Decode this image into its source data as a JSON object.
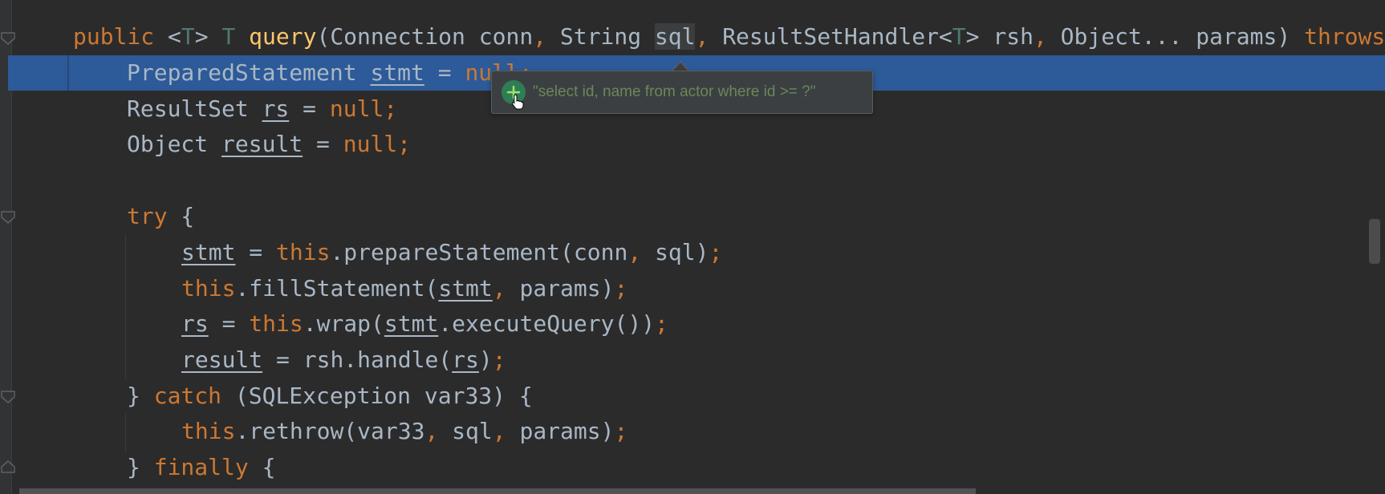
{
  "editor": {
    "selected_identifier": "sql"
  },
  "code": {
    "line1": {
      "kw_public": "public",
      "lt": " <",
      "t1": "T",
      "gt": "> ",
      "t2": "T",
      "sp": " ",
      "fn_query": "query",
      "args1": "(Connection conn",
      "c1": ",",
      "args2": " String ",
      "sql": "sql",
      "c2": ",",
      "args3": " ResultSetHandler<",
      "t3": "T",
      "args4": "> rsh",
      "c3": ",",
      "args5": " Object... params) ",
      "kw_throws": "throws"
    },
    "line2": {
      "type": "PreparedStatement ",
      "var": "stmt",
      "eq": " = ",
      "nul": "null;"
    },
    "line3": {
      "type": "ResultSet ",
      "var": "rs",
      "eq": " = ",
      "nul": "null;"
    },
    "line4": {
      "type": "Object ",
      "var": "result",
      "eq": " = ",
      "nul": "null;"
    },
    "line5": {
      "kw": "try",
      "rest": " {"
    },
    "line6": {
      "var": "stmt",
      "eq": " = ",
      "kw": "this",
      "call": ".prepareStatement(conn",
      "comma": ",",
      "rest": " sql)",
      "semi": ";"
    },
    "line7": {
      "kw": "this",
      "call": ".fillStatement(",
      "var": "stmt",
      "comma": ",",
      "rest": " params)",
      "semi": ";"
    },
    "line8": {
      "var": "rs",
      "eq": " = ",
      "kw": "this",
      "call": ".wrap(",
      "var2": "stmt",
      "rest": ".executeQuery())",
      "semi": ";"
    },
    "line9": {
      "var": "result",
      "call": " = rsh.handle(",
      "var2": "rs",
      "rest": ")",
      "semi": ";"
    },
    "line10": {
      "brace": "} ",
      "kw": "catch",
      "rest": " (SQLException var33) {"
    },
    "line11": {
      "kw": "this",
      "call": ".rethrow(var33",
      "c1": ",",
      "mid": " sql",
      "c2": ",",
      "rest": " params)",
      "semi": ";"
    },
    "line12": {
      "brace": "} ",
      "kw": "finally",
      "rest": " {"
    }
  },
  "popup": {
    "icon": "add-watch-icon",
    "value": "\"select id, name from actor where id >= ?\""
  },
  "colors": {
    "background": "#2b2b2b",
    "keyword": "#cc7832",
    "method": "#ffc66d",
    "text": "#a9b7c6",
    "string": "#6a8759",
    "current_line": "#2d5a98"
  }
}
